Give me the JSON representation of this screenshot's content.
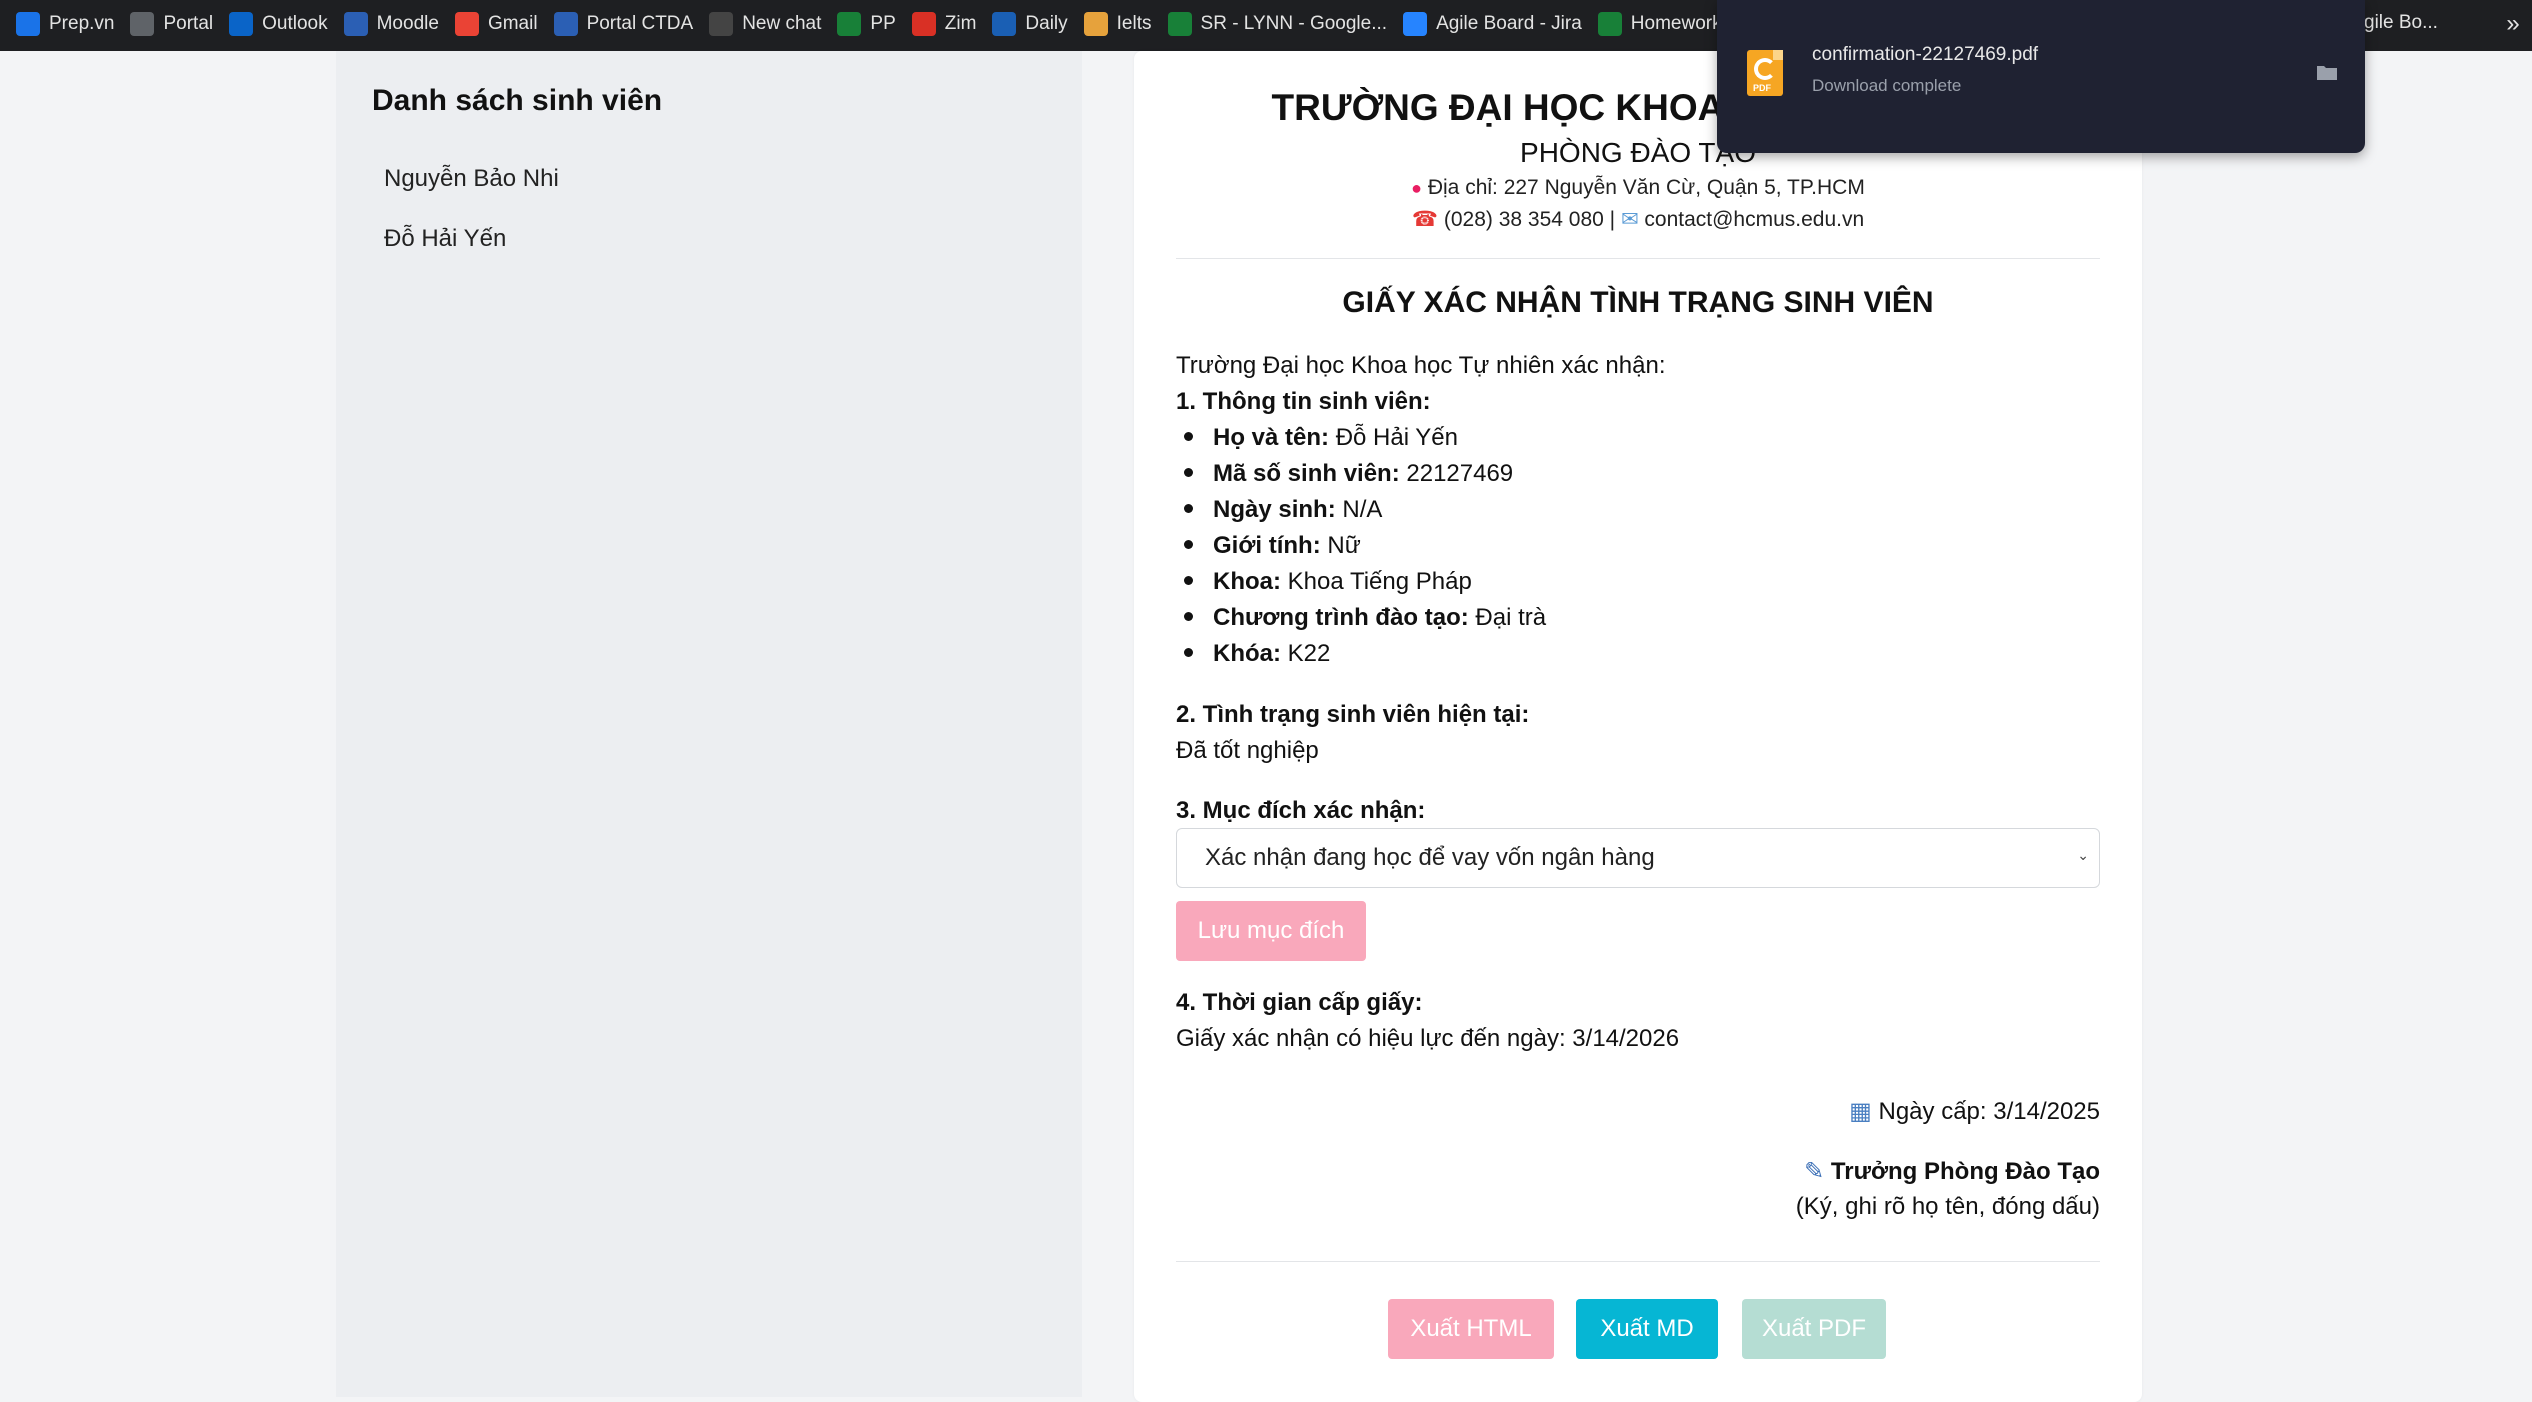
{
  "bookmarks": [
    {
      "label": "Prep.vn",
      "icon": "prep-icon",
      "color": "#1a73e8"
    },
    {
      "label": "Portal",
      "icon": "portal-icon",
      "color": "#5f6368"
    },
    {
      "label": "Outlook",
      "icon": "outlook-icon",
      "color": "#0a64c8"
    },
    {
      "label": "Moodle",
      "icon": "moodle-icon",
      "color": "#2b5fb4"
    },
    {
      "label": "Gmail",
      "icon": "gmail-icon",
      "color": "#ea4335"
    },
    {
      "label": "Portal CTDA",
      "icon": "portal-ctda-icon",
      "color": "#2b5fb4"
    },
    {
      "label": "New chat",
      "icon": "chat-icon",
      "color": "#444"
    },
    {
      "label": "PP",
      "icon": "drive-icon",
      "color": "#188038"
    },
    {
      "label": "Zim",
      "icon": "zim-icon",
      "color": "#d93025"
    },
    {
      "label": "Daily",
      "icon": "daily-icon",
      "color": "#1a5fb4"
    },
    {
      "label": "Ielts",
      "icon": "ielts-icon",
      "color": "#e6a23c"
    },
    {
      "label": "SR - LYNN - Google...",
      "icon": "drive-icon",
      "color": "#188038"
    },
    {
      "label": "Agile Board - Jira",
      "icon": "jira-icon",
      "color": "#2684ff"
    },
    {
      "label": "Homework - G",
      "icon": "drive-icon",
      "color": "#188038"
    }
  ],
  "bookmark_tail": "gile Bo...",
  "bookmark_more": "»",
  "sidebar": {
    "title": "Danh sách sinh viên",
    "students": [
      "Nguyễn Bảo Nhi",
      "Đỗ Hải Yến"
    ]
  },
  "header": {
    "university": "TRƯỜNG ĐẠI HỌC KHOA HỌC TỰ NHIÊN",
    "office": "PHÒNG ĐÀO TẠO",
    "address": "Địa chỉ: 227 Nguyễn Văn Cừ, Quận 5, TP.HCM",
    "phone": "(028) 38 354 080 |",
    "email": "contact@hcmus.edu.vn"
  },
  "document": {
    "title": "GIẤY XÁC NHẬN TÌNH TRẠNG SINH VIÊN",
    "intro": "Trường Đại học Khoa học Tự nhiên xác nhận:",
    "section1": "1. Thông tin sinh viên:",
    "info": [
      {
        "label": "Họ và tên:",
        "value": "Đỗ Hải Yến"
      },
      {
        "label": "Mã số sinh viên:",
        "value": "22127469"
      },
      {
        "label": "Ngày sinh:",
        "value": "N/A"
      },
      {
        "label": "Giới tính:",
        "value": "Nữ"
      },
      {
        "label": "Khoa:",
        "value": "Khoa Tiếng Pháp"
      },
      {
        "label": "Chương trình đào tạo:",
        "value": "Đại trà"
      },
      {
        "label": "Khóa:",
        "value": "K22"
      }
    ],
    "section2": "2. Tình trạng sinh viên hiện tại:",
    "status": "Đã tốt nghiệp",
    "section3": "3. Mục đích xác nhận:",
    "purpose_selected": "Xác nhận đang học để vay vốn ngân hàng",
    "save_purpose": "Lưu mục đích",
    "section4": "4. Thời gian cấp giấy:",
    "validity": "Giấy xác nhận có hiệu lực đến ngày: 3/14/2026",
    "issue_date": "Ngày cấp: 3/14/2025",
    "signer": "Trưởng Phòng Đào Tạo",
    "signer_note": "(Ký, ghi rõ họ tên, đóng dấu)"
  },
  "export": {
    "html": "Xuất HTML",
    "md": "Xuất MD",
    "pdf": "Xuất PDF"
  },
  "colors": {
    "btn_pink": "#f9a8bb",
    "btn_cyan": "#06b6d4",
    "btn_teal_disabled": "#b5ddd3",
    "popup_bg": "#1f2232"
  },
  "download": {
    "filename": "confirmation-22127469.pdf",
    "status": "Download complete",
    "icon_label": "PDF"
  }
}
